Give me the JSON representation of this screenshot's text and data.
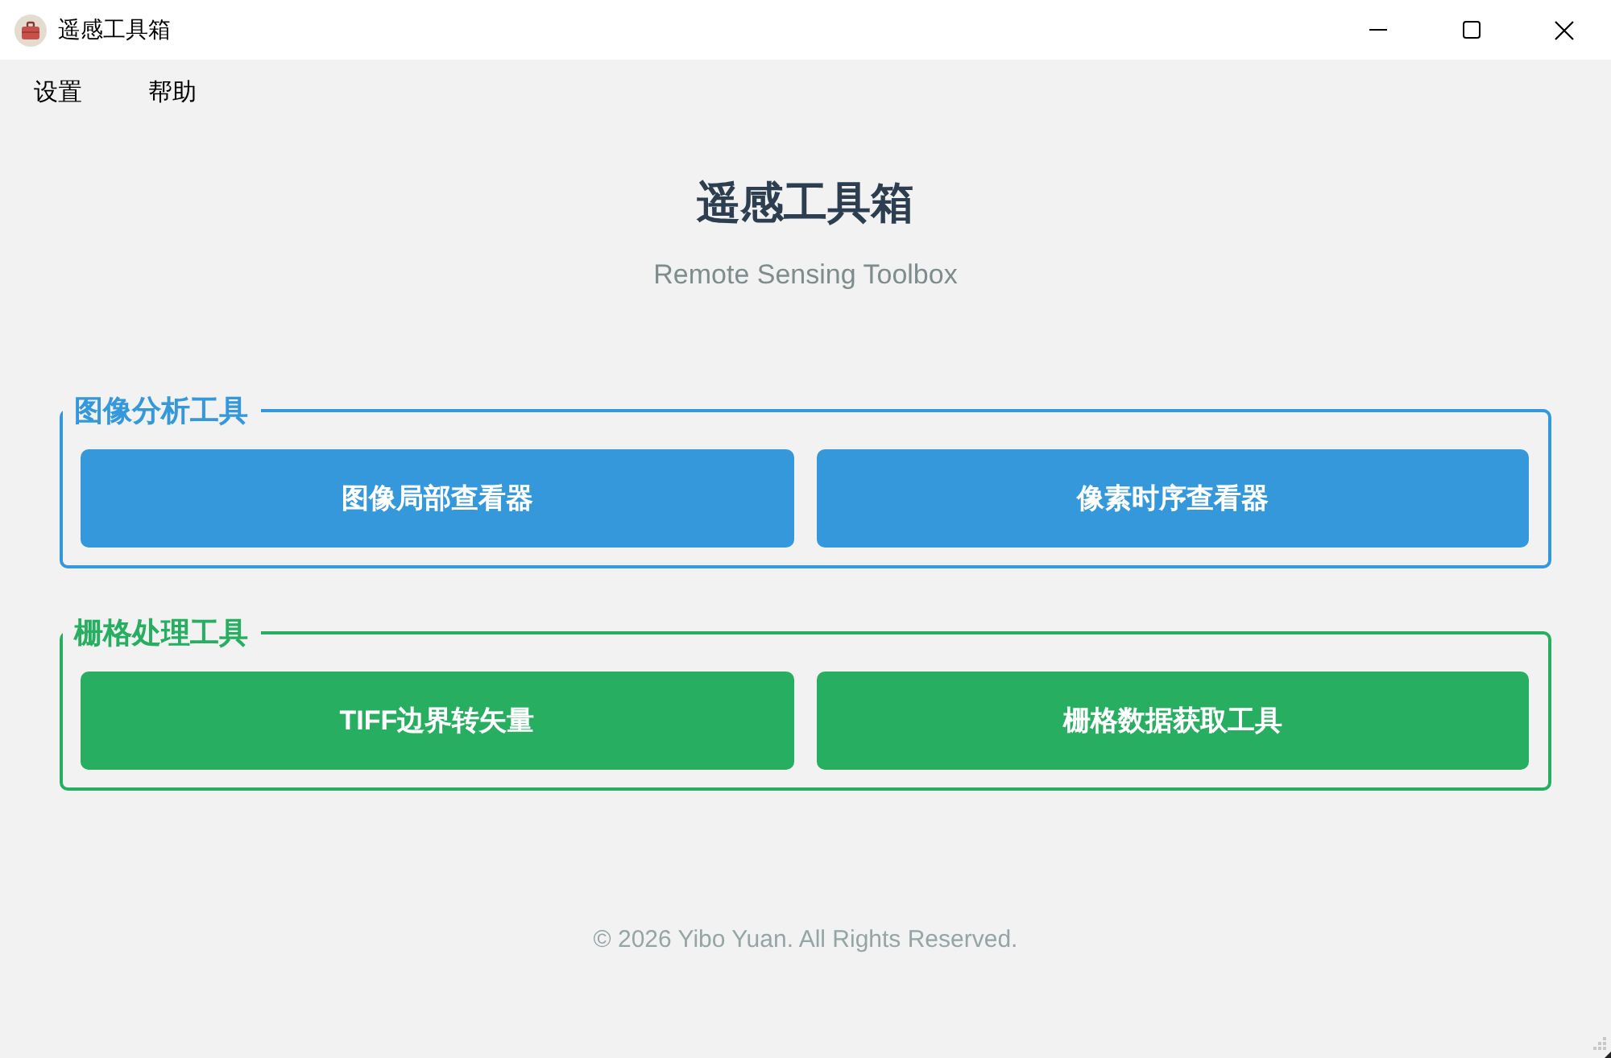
{
  "window": {
    "title": "遥感工具箱"
  },
  "menu": [
    {
      "label": "设置"
    },
    {
      "label": "帮助"
    }
  ],
  "header": {
    "title": "遥感工具箱",
    "subtitle": "Remote Sensing Toolbox"
  },
  "groups": [
    {
      "title": "图像分析工具",
      "color": "#3498db",
      "buttons": [
        "图像局部查看器",
        "像素时序查看器"
      ]
    },
    {
      "title": "栅格处理工具",
      "color": "#27ae60",
      "buttons": [
        "TIFF边界转矢量",
        "栅格数据获取工具"
      ]
    }
  ],
  "footer": "© 2026 Yibo Yuan. All Rights Reserved."
}
